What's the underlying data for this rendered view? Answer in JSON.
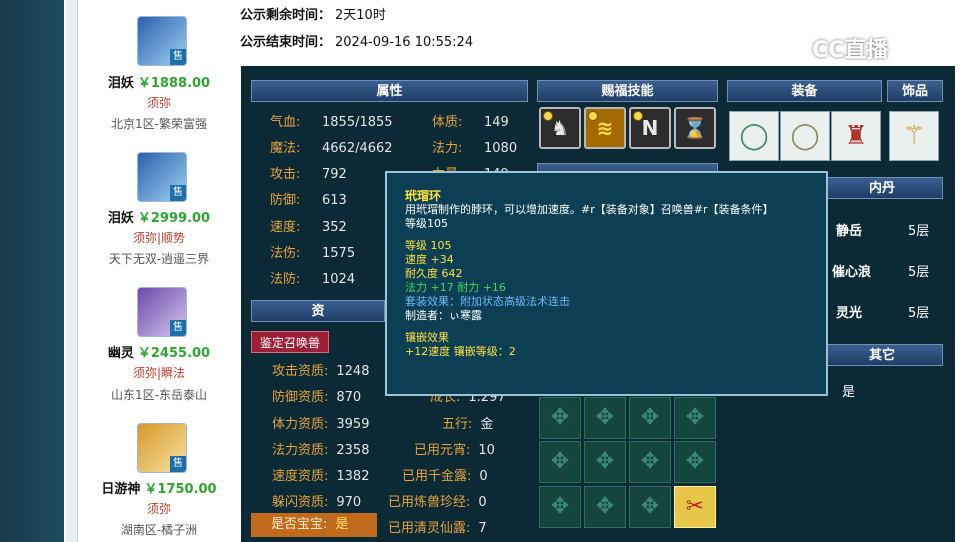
{
  "listing": [
    {
      "name": "泪妖",
      "price": "￥1888.00",
      "tags": "须弥",
      "server": "北京1区-繁荣富强",
      "sell": "售"
    },
    {
      "name": "泪妖",
      "price": "￥2999.00",
      "tags": "须弥|顺势",
      "server": "天下无双-逍遥三界",
      "sell": "售"
    },
    {
      "name": "幽灵",
      "price": "￥2455.00",
      "tags": "须弥|瞬法",
      "server": "山东1区-东岳泰山",
      "sell": "售"
    },
    {
      "name": "日游神",
      "price": "￥1750.00",
      "tags": "须弥",
      "server": "湖南区-橘子洲",
      "sell": "售"
    }
  ],
  "publicity": {
    "remain_label": "公示剩余时间：",
    "remain_value": "2天10时",
    "end_label": "公示结束时间：",
    "end_value": "2024-09-16 10:55:24"
  },
  "watermark": "CC直播",
  "headers": {
    "attributes": "属性",
    "skills": "赐福技能",
    "equipment": "装备",
    "accessory": "饰品",
    "neidan_partial": "内丹",
    "other_partial": "其它",
    "zizhi_partial": "资"
  },
  "attributes_left": [
    {
      "k": "气血:",
      "v": "1855/1855"
    },
    {
      "k": "魔法:",
      "v": "4662/4662"
    },
    {
      "k": "攻击:",
      "v": "792"
    },
    {
      "k": "防御:",
      "v": "613"
    },
    {
      "k": "速度:",
      "v": "352"
    },
    {
      "k": "法伤:",
      "v": "1575"
    },
    {
      "k": "法防:",
      "v": "1024"
    }
  ],
  "attributes_right": [
    {
      "k": "体质:",
      "v": "149"
    },
    {
      "k": "法力:",
      "v": "1080"
    },
    {
      "k": "力量:",
      "v": "149"
    }
  ],
  "summon_button": "鉴定召唤兽",
  "zizhi": [
    {
      "k": "攻击资质:",
      "v": "1248"
    },
    {
      "k": "防御资质:",
      "v": "870"
    },
    {
      "k": "体力资质:",
      "v": "3959"
    },
    {
      "k": "法力资质:",
      "v": "2358"
    },
    {
      "k": "速度资质:",
      "v": "1382"
    },
    {
      "k": "躲闪资质:",
      "v": "970"
    }
  ],
  "zizhi_right": [
    {
      "k": "成长:",
      "v": "1.297"
    },
    {
      "k": "五行:",
      "v": "金"
    },
    {
      "k": "已用元宵:",
      "v": "10"
    },
    {
      "k": "已用千金露:",
      "v": "0"
    },
    {
      "k": "已用炼兽珍经:",
      "v": "0"
    },
    {
      "k": "已用清灵仙露:",
      "v": "7"
    }
  ],
  "baobao": {
    "k": "是否宝宝:",
    "v": "是"
  },
  "neidan": [
    {
      "name": "静岳",
      "level": "5层"
    },
    {
      "name": "催心浪",
      "level": "5层"
    },
    {
      "name": "灵光",
      "level": "5层"
    }
  ],
  "other_value": "是",
  "tooltip": {
    "title": "玳瑁环",
    "desc": "用玳瑁制作的脖环，可以增加速度。#r【装备对象】召唤兽#r【装备条件】",
    "req_level": "等级105",
    "level": "等级 105",
    "speed": "速度 +34",
    "durability": "耐久度 642",
    "bonus": "法力 +17 耐力 +16",
    "set_effect": "套装效果：附加状态高级法术连击",
    "maker": "制造者：ぃ寒露",
    "inlay_title": "镶嵌效果",
    "inlay_detail": "+12速度 镶嵌等级：2"
  },
  "icons": {
    "skills": [
      "dark-helm-icon",
      "wave-signal-icon",
      "broken-n-icon",
      "hourglass-icon"
    ],
    "equipment": [
      "jade-ring-icon",
      "silver-ring-icon",
      "red-armor-icon"
    ],
    "accessory": "golden-staff-icon"
  }
}
